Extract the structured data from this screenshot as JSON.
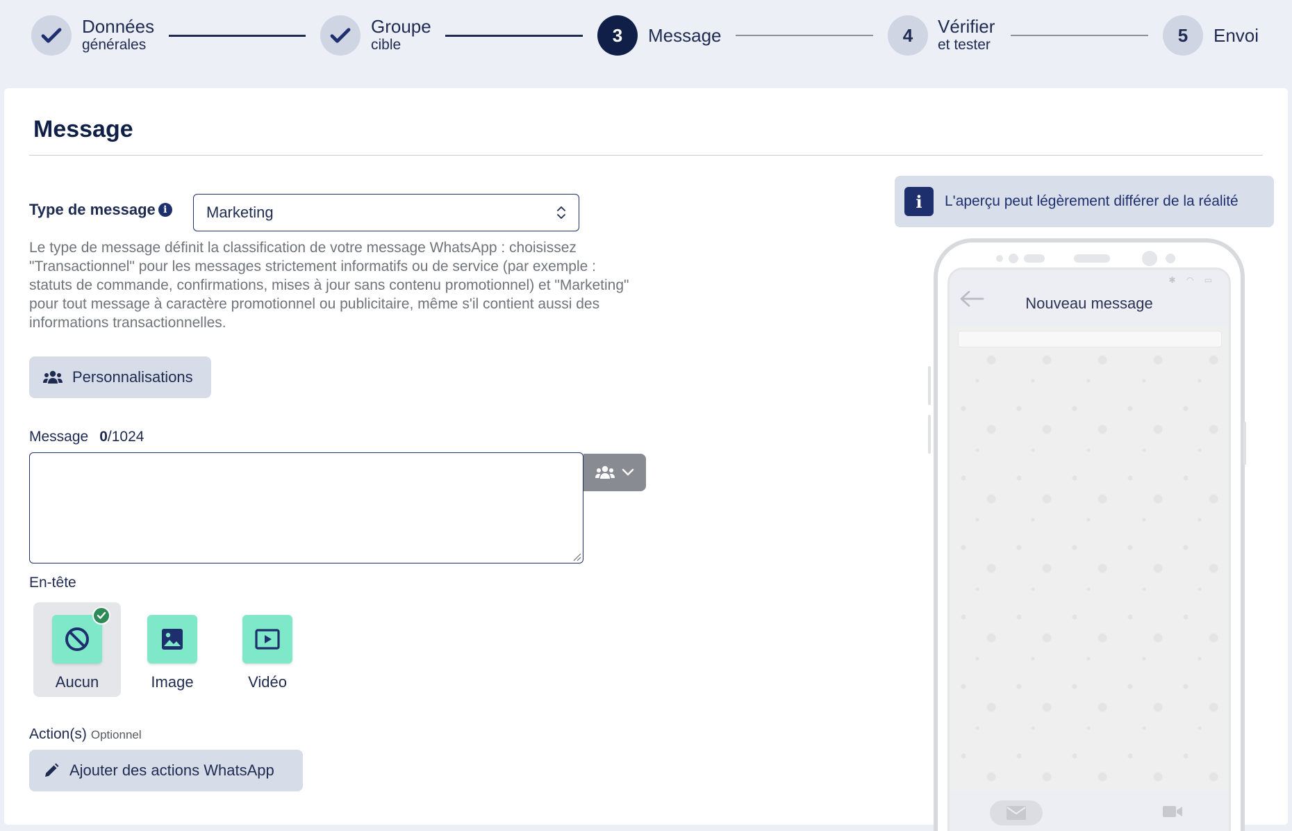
{
  "stepper": {
    "steps": [
      {
        "number": "",
        "title": "Données",
        "subtitle": "générales",
        "state": "done"
      },
      {
        "number": "",
        "title": "Groupe",
        "subtitle": "cible",
        "state": "done"
      },
      {
        "number": "3",
        "title": "Message",
        "subtitle": "",
        "state": "active"
      },
      {
        "number": "4",
        "title": "Vérifier",
        "subtitle": "et tester",
        "state": "todo"
      },
      {
        "number": "5",
        "title": "Envoi",
        "subtitle": "",
        "state": "todo"
      }
    ]
  },
  "form": {
    "title": "Message",
    "type_label": "Type de message",
    "type_value": "Marketing",
    "type_help": "Le type de message définit la classification de votre message WhatsApp : choisissez \"Transactionnel\" pour les messages strictement informatifs ou de service (par exemple : statuts de commande, confirmations, mises à jour sans contenu promotionnel) et \"Marketing\" pour tout message à caractère promotionnel ou publicitaire, même s'il contient aussi des informations transactionnelles.",
    "personalisations_button": "Personnalisations",
    "message_label": "Message",
    "message_count": "0",
    "message_max": "/1024",
    "message_value": "",
    "header_label": "En-tête",
    "header_options": [
      {
        "label": "Aucun",
        "icon": "ban-icon",
        "selected": true
      },
      {
        "label": "Image",
        "icon": "image-icon",
        "selected": false
      },
      {
        "label": "Vidéo",
        "icon": "video-icon",
        "selected": false
      }
    ],
    "actions_label": "Action(s)",
    "actions_optional": "Optionnel",
    "actions_button": "Ajouter des actions WhatsApp"
  },
  "preview": {
    "note": "L'aperçu peut légèrement différer de la réalité",
    "phone_title": "Nouveau message"
  },
  "colors": {
    "navy": "#0f1f47",
    "accent_tile": "#7ee8c9",
    "selected_check": "#2e8b57"
  }
}
